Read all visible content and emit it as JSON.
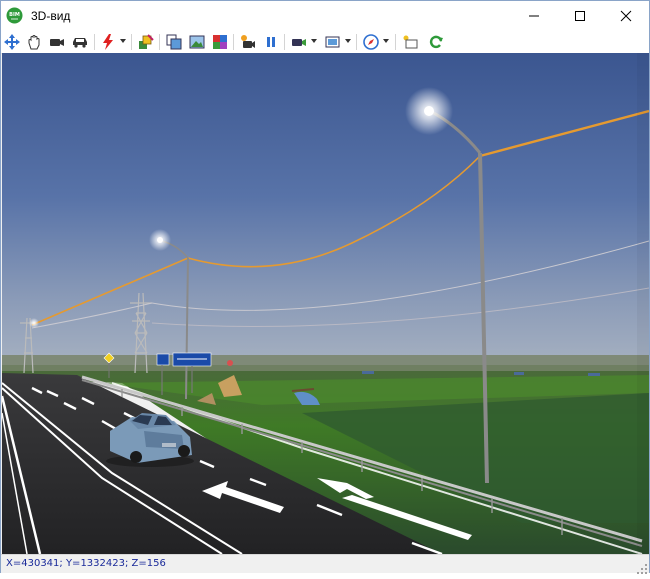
{
  "window": {
    "title": "3D-вид",
    "app_icon": "bim-logo-icon",
    "app_icon_text": "BIM",
    "controls": [
      "minimize-icon",
      "maximize-icon",
      "close-icon"
    ]
  },
  "toolbar": {
    "buttons": [
      {
        "name": "move-tool-icon",
        "dropdown": false
      },
      {
        "name": "pan-hand-icon",
        "dropdown": false
      },
      {
        "name": "camera-icon",
        "dropdown": false
      },
      {
        "name": "car-icon",
        "dropdown": false
      },
      {
        "name": "lightning-icon",
        "dropdown": true
      },
      {
        "name": "layers-paint-icon",
        "dropdown": false
      },
      {
        "name": "copy-view-icon",
        "dropdown": false
      },
      {
        "name": "image-view-icon",
        "dropdown": false
      },
      {
        "name": "materials-icon",
        "dropdown": false
      },
      {
        "name": "record-camera-icon",
        "dropdown": false
      },
      {
        "name": "pause-icon",
        "dropdown": false
      },
      {
        "name": "video-camera-icon",
        "dropdown": true
      },
      {
        "name": "export-image-icon",
        "dropdown": true
      },
      {
        "name": "compass-icon",
        "dropdown": true
      },
      {
        "name": "light-comment-icon",
        "dropdown": false
      },
      {
        "name": "refresh-icon",
        "dropdown": false
      }
    ]
  },
  "scene": {
    "sky_top": "#3d5a94",
    "sky_horizon": "#a8b4c4",
    "grass": "#3f7a26",
    "road": "#2c2c2e",
    "car_color": "#7b9ab8",
    "wire_color": "#e59a30"
  },
  "status": {
    "coords": "X=430341; Y=1332423; Z=156"
  }
}
